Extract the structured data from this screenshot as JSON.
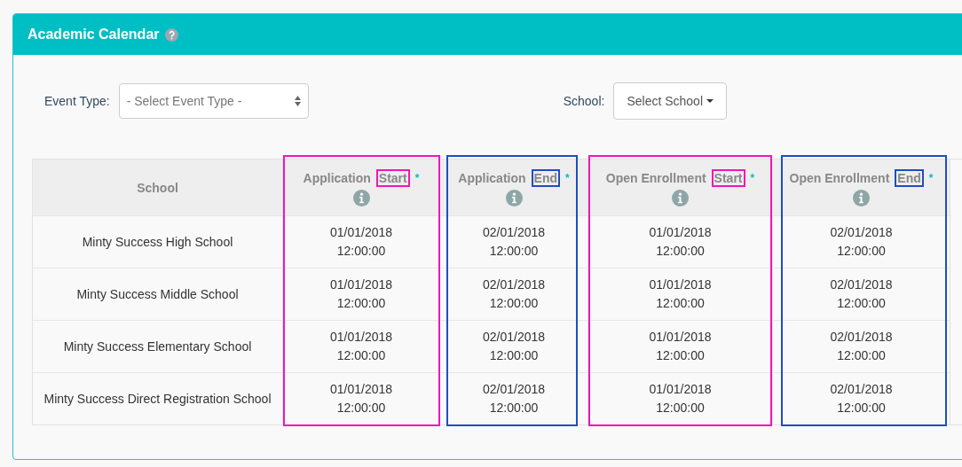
{
  "panel": {
    "title": "Academic Calendar"
  },
  "filters": {
    "event_type": {
      "label": "Event Type:",
      "placeholder": "- Select Event Type -"
    },
    "school": {
      "label": "School:",
      "button": "Select School"
    }
  },
  "table": {
    "school_column": "School",
    "columns": [
      {
        "label": "Application",
        "highlight": "Start",
        "marker": "*",
        "color": "#ee18b8"
      },
      {
        "label": "Application",
        "highlight": "End",
        "marker": "*",
        "color": "#1d4fbf"
      },
      {
        "label": "Open Enrollment",
        "highlight": "Start",
        "marker": "*",
        "color": "#ee18b8"
      },
      {
        "label": "Open Enrollment",
        "highlight": "End",
        "marker": "*",
        "color": "#1d4fbf"
      }
    ],
    "rows": [
      {
        "school": "Minty Success High School",
        "cells": [
          {
            "date": "01/01/2018",
            "time": "12:00:00"
          },
          {
            "date": "02/01/2018",
            "time": "12:00:00"
          },
          {
            "date": "01/01/2018",
            "time": "12:00:00"
          },
          {
            "date": "02/01/2018",
            "time": "12:00:00"
          }
        ]
      },
      {
        "school": "Minty Success Middle School",
        "cells": [
          {
            "date": "01/01/2018",
            "time": "12:00:00"
          },
          {
            "date": "02/01/2018",
            "time": "12:00:00"
          },
          {
            "date": "01/01/2018",
            "time": "12:00:00"
          },
          {
            "date": "02/01/2018",
            "time": "12:00:00"
          }
        ]
      },
      {
        "school": "Minty Success Elementary School",
        "cells": [
          {
            "date": "01/01/2018",
            "time": "12:00:00"
          },
          {
            "date": "02/01/2018",
            "time": "12:00:00"
          },
          {
            "date": "01/01/2018",
            "time": "12:00:00"
          },
          {
            "date": "02/01/2018",
            "time": "12:00:00"
          }
        ]
      },
      {
        "school": "Minty Success Direct Registration School",
        "cells": [
          {
            "date": "01/01/2018",
            "time": "12:00:00"
          },
          {
            "date": "02/01/2018",
            "time": "12:00:00"
          },
          {
            "date": "01/01/2018",
            "time": "12:00:00"
          },
          {
            "date": "02/01/2018",
            "time": "12:00:00"
          }
        ]
      }
    ]
  }
}
